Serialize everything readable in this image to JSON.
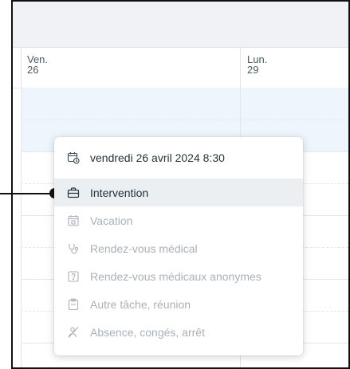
{
  "calendar": {
    "columns": [
      {
        "day_name": "Ven.",
        "day_number": "26"
      },
      {
        "day_name": "Lun.",
        "day_number": "29"
      }
    ]
  },
  "menu": {
    "header": {
      "icon": "calendar-clock-icon",
      "text": "vendredi 26 avril 2024 8:30"
    },
    "items": [
      {
        "label": "Intervention",
        "icon": "briefcase-icon",
        "state": "active"
      },
      {
        "label": "Vacation",
        "icon": "calendar-day-icon",
        "state": "disabled"
      },
      {
        "label": "Rendez-vous médical",
        "icon": "stethoscope-icon",
        "state": "disabled"
      },
      {
        "label": "Rendez-vous médicaux anonymes",
        "icon": "anonymous-question-icon",
        "state": "disabled"
      },
      {
        "label": "Autre tâche, réunion",
        "icon": "clipboard-icon",
        "state": "disabled"
      },
      {
        "label": "Absence, congés, arrêt",
        "icon": "absence-icon",
        "state": "disabled"
      }
    ]
  },
  "colors": {
    "active_text": "#263238",
    "disabled_text": "#a9b1b8",
    "active_bg": "#eceff2",
    "band_blue": "#eef5fc",
    "header_bg": "#f0f2f5"
  }
}
